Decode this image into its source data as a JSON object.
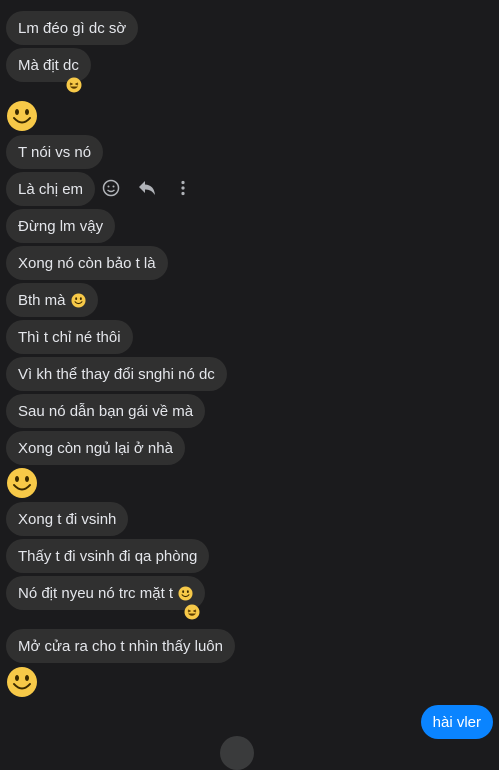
{
  "messages": [
    {
      "text": "Lm đéo gì dc sờ"
    },
    {
      "text": "Mà địt dc",
      "reaction": "laughing-emoji"
    },
    {
      "text": "T nói vs nó"
    },
    {
      "text": "Là chị em"
    },
    {
      "text": "Đừng lm vậy"
    },
    {
      "text": "Xong nó còn bảo t là"
    },
    {
      "text": "Bth mà",
      "inline_emoji": "smile-emoji"
    },
    {
      "text": "Thì t chỉ né thôi"
    },
    {
      "text": "Vì kh thể thay đổi snghi nó dc"
    },
    {
      "text": "Sau nó dẫn bạn gái về mà"
    },
    {
      "text": "Xong còn ngủ lại ở nhà"
    },
    {
      "text": "Xong t đi vsinh"
    },
    {
      "text": "Thấy t đi vsinh đi qa phòng"
    },
    {
      "text": "Nó địt nyeu nó trc mặt t",
      "inline_emoji": "smile-emoji",
      "reaction": "laughing-emoji"
    },
    {
      "text": "Mở cửa ra cho t nhìn thấy luôn"
    }
  ],
  "big_emojis": [
    "smile-emoji",
    "smile-emoji",
    "smile-emoji"
  ],
  "message_actions": [
    "react-icon",
    "reply-icon",
    "more-icon"
  ],
  "sent_message": {
    "text": "hài vler"
  },
  "colors": {
    "background": "#1b1b1d",
    "bubble": "#303030",
    "sent_bubble": "#0a84ff",
    "text": "#e4e6eb",
    "emoji": "#f7c948"
  }
}
